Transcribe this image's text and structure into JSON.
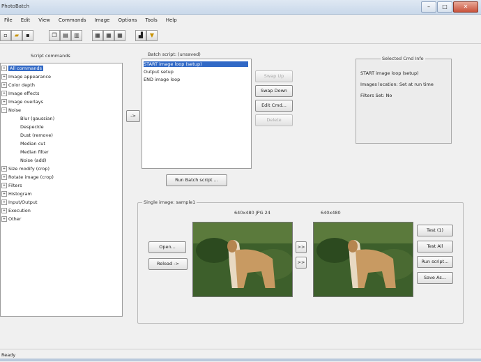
{
  "window": {
    "title": "PhotoBatch",
    "min_glyph": "–",
    "max_glyph": "□",
    "close_glyph": "✕"
  },
  "menu": [
    "File",
    "Edit",
    "View",
    "Commands",
    "Image",
    "Options",
    "Tools",
    "Help"
  ],
  "toolbar_icons": [
    "new-icon",
    "open-icon",
    "save-icon",
    "copy-icon",
    "paste-icon",
    "print-icon",
    "grid-icon",
    "grid-icon",
    "grid-icon",
    "chart-icon",
    "filter-icon"
  ],
  "left_panel": {
    "title": "Script commands",
    "items": [
      {
        "label": "All commands",
        "expander": "+",
        "selected": true
      },
      {
        "label": "Image appearance",
        "expander": "+"
      },
      {
        "label": "Color depth",
        "expander": "+"
      },
      {
        "label": "Image effects",
        "expander": "+"
      },
      {
        "label": "Image overlays",
        "expander": "+"
      },
      {
        "label": "Noise",
        "expander": "−"
      },
      {
        "label": "Blur (gaussian)",
        "child": true
      },
      {
        "label": "Despeckle",
        "child": true
      },
      {
        "label": "Dust (remove)",
        "child": true
      },
      {
        "label": "Median cut",
        "child": true
      },
      {
        "label": "Median filter",
        "child": true
      },
      {
        "label": "Noise (add)",
        "child": true
      },
      {
        "label": "Size modify (crop)",
        "expander": "+"
      },
      {
        "label": "Rotate image (crop)",
        "expander": "+"
      },
      {
        "label": "Filters",
        "expander": "+"
      },
      {
        "label": "Histogram",
        "expander": "+"
      },
      {
        "label": "Input/Output",
        "expander": "+"
      },
      {
        "label": "Execution",
        "expander": "+"
      },
      {
        "label": "Other",
        "expander": "+"
      }
    ]
  },
  "add_button": "->",
  "batch": {
    "title": "Batch script: (unsaved)",
    "items": [
      {
        "label": "START image loop (setup)",
        "selected": true
      },
      {
        "label": "Output setup"
      },
      {
        "label": "END image loop"
      }
    ],
    "buttons": {
      "swap_up": "Swap Up",
      "swap_down": "Swap Down",
      "edit": "Edit Cmd...",
      "delete": "Delete"
    },
    "run": "Run Batch script ..."
  },
  "info": {
    "title": "Selected Cmd Info",
    "lines": [
      "START image loop (setup)",
      "Images location: Set at run time",
      "Filters Set: No"
    ]
  },
  "single": {
    "title": "Single image: sample1",
    "left_caption": "640x480 JPG 24",
    "right_caption": "640x480",
    "open": "Open...",
    "reload": "Reload ->",
    "arrow1": ">>",
    "arrow2": ">>",
    "test1": "Test (1)",
    "test_all": "Test All",
    "run_script": "Run script...",
    "save_as": "Save As..."
  },
  "status": "Ready"
}
